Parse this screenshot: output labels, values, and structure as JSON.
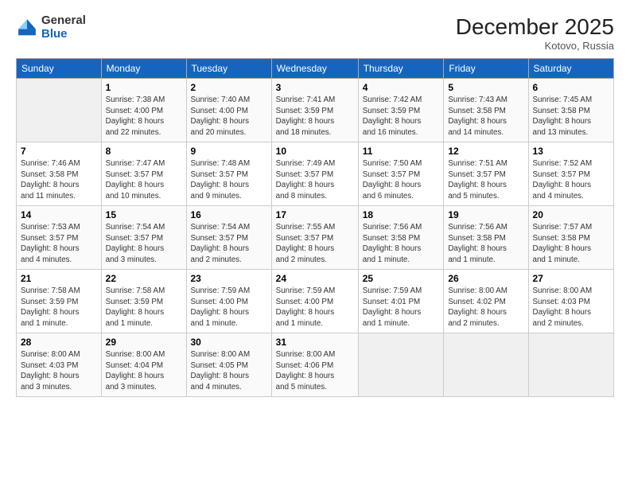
{
  "logo": {
    "general": "General",
    "blue": "Blue"
  },
  "header": {
    "month": "December 2025",
    "location": "Kotovo, Russia"
  },
  "weekdays": [
    "Sunday",
    "Monday",
    "Tuesday",
    "Wednesday",
    "Thursday",
    "Friday",
    "Saturday"
  ],
  "weeks": [
    [
      {
        "day": "",
        "info": ""
      },
      {
        "day": "1",
        "info": "Sunrise: 7:38 AM\nSunset: 4:00 PM\nDaylight: 8 hours\nand 22 minutes."
      },
      {
        "day": "2",
        "info": "Sunrise: 7:40 AM\nSunset: 4:00 PM\nDaylight: 8 hours\nand 20 minutes."
      },
      {
        "day": "3",
        "info": "Sunrise: 7:41 AM\nSunset: 3:59 PM\nDaylight: 8 hours\nand 18 minutes."
      },
      {
        "day": "4",
        "info": "Sunrise: 7:42 AM\nSunset: 3:59 PM\nDaylight: 8 hours\nand 16 minutes."
      },
      {
        "day": "5",
        "info": "Sunrise: 7:43 AM\nSunset: 3:58 PM\nDaylight: 8 hours\nand 14 minutes."
      },
      {
        "day": "6",
        "info": "Sunrise: 7:45 AM\nSunset: 3:58 PM\nDaylight: 8 hours\nand 13 minutes."
      }
    ],
    [
      {
        "day": "7",
        "info": "Sunrise: 7:46 AM\nSunset: 3:58 PM\nDaylight: 8 hours\nand 11 minutes."
      },
      {
        "day": "8",
        "info": "Sunrise: 7:47 AM\nSunset: 3:57 PM\nDaylight: 8 hours\nand 10 minutes."
      },
      {
        "day": "9",
        "info": "Sunrise: 7:48 AM\nSunset: 3:57 PM\nDaylight: 8 hours\nand 9 minutes."
      },
      {
        "day": "10",
        "info": "Sunrise: 7:49 AM\nSunset: 3:57 PM\nDaylight: 8 hours\nand 8 minutes."
      },
      {
        "day": "11",
        "info": "Sunrise: 7:50 AM\nSunset: 3:57 PM\nDaylight: 8 hours\nand 6 minutes."
      },
      {
        "day": "12",
        "info": "Sunrise: 7:51 AM\nSunset: 3:57 PM\nDaylight: 8 hours\nand 5 minutes."
      },
      {
        "day": "13",
        "info": "Sunrise: 7:52 AM\nSunset: 3:57 PM\nDaylight: 8 hours\nand 4 minutes."
      }
    ],
    [
      {
        "day": "14",
        "info": "Sunrise: 7:53 AM\nSunset: 3:57 PM\nDaylight: 8 hours\nand 4 minutes."
      },
      {
        "day": "15",
        "info": "Sunrise: 7:54 AM\nSunset: 3:57 PM\nDaylight: 8 hours\nand 3 minutes."
      },
      {
        "day": "16",
        "info": "Sunrise: 7:54 AM\nSunset: 3:57 PM\nDaylight: 8 hours\nand 2 minutes."
      },
      {
        "day": "17",
        "info": "Sunrise: 7:55 AM\nSunset: 3:57 PM\nDaylight: 8 hours\nand 2 minutes."
      },
      {
        "day": "18",
        "info": "Sunrise: 7:56 AM\nSunset: 3:58 PM\nDaylight: 8 hours\nand 1 minute."
      },
      {
        "day": "19",
        "info": "Sunrise: 7:56 AM\nSunset: 3:58 PM\nDaylight: 8 hours\nand 1 minute."
      },
      {
        "day": "20",
        "info": "Sunrise: 7:57 AM\nSunset: 3:58 PM\nDaylight: 8 hours\nand 1 minute."
      }
    ],
    [
      {
        "day": "21",
        "info": "Sunrise: 7:58 AM\nSunset: 3:59 PM\nDaylight: 8 hours\nand 1 minute."
      },
      {
        "day": "22",
        "info": "Sunrise: 7:58 AM\nSunset: 3:59 PM\nDaylight: 8 hours\nand 1 minute."
      },
      {
        "day": "23",
        "info": "Sunrise: 7:59 AM\nSunset: 4:00 PM\nDaylight: 8 hours\nand 1 minute."
      },
      {
        "day": "24",
        "info": "Sunrise: 7:59 AM\nSunset: 4:00 PM\nDaylight: 8 hours\nand 1 minute."
      },
      {
        "day": "25",
        "info": "Sunrise: 7:59 AM\nSunset: 4:01 PM\nDaylight: 8 hours\nand 1 minute."
      },
      {
        "day": "26",
        "info": "Sunrise: 8:00 AM\nSunset: 4:02 PM\nDaylight: 8 hours\nand 2 minutes."
      },
      {
        "day": "27",
        "info": "Sunrise: 8:00 AM\nSunset: 4:03 PM\nDaylight: 8 hours\nand 2 minutes."
      }
    ],
    [
      {
        "day": "28",
        "info": "Sunrise: 8:00 AM\nSunset: 4:03 PM\nDaylight: 8 hours\nand 3 minutes."
      },
      {
        "day": "29",
        "info": "Sunrise: 8:00 AM\nSunset: 4:04 PM\nDaylight: 8 hours\nand 3 minutes."
      },
      {
        "day": "30",
        "info": "Sunrise: 8:00 AM\nSunset: 4:05 PM\nDaylight: 8 hours\nand 4 minutes."
      },
      {
        "day": "31",
        "info": "Sunrise: 8:00 AM\nSunset: 4:06 PM\nDaylight: 8 hours\nand 5 minutes."
      },
      {
        "day": "",
        "info": ""
      },
      {
        "day": "",
        "info": ""
      },
      {
        "day": "",
        "info": ""
      }
    ]
  ]
}
